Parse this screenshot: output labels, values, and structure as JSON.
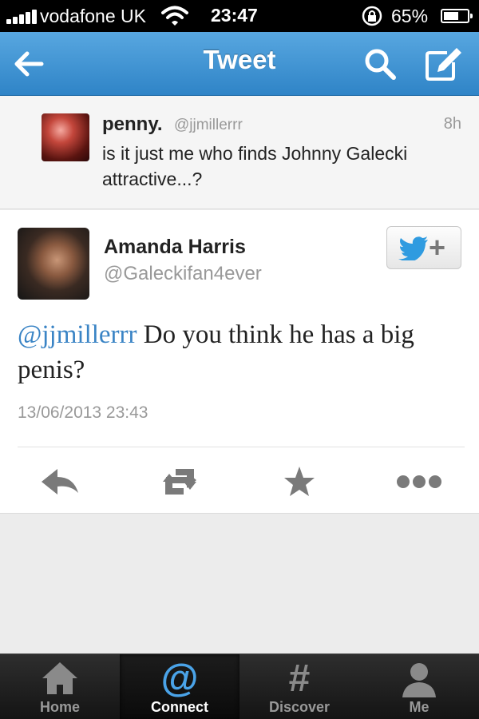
{
  "status_bar": {
    "carrier": "vodafone UK",
    "time": "23:47",
    "battery_percent": "65%",
    "battery_level": 0.65
  },
  "nav": {
    "title": "Tweet",
    "icons": [
      "back-arrow-icon",
      "search-icon",
      "compose-icon"
    ]
  },
  "parent_tweet": {
    "name": "penny.",
    "handle": "@jjmillerrr",
    "time": "8h",
    "text": "is it just me who finds Johnny Galecki attractive...?"
  },
  "main_tweet": {
    "name": "Amanda Harris",
    "handle": "@Galeckifan4ever",
    "mention": "@jjmillerrr",
    "text": " Do you think he has a big penis?",
    "date": "13/06/2013 23:43",
    "follow_icon": "twitter-follow-icon",
    "actions": [
      "reply-icon",
      "retweet-icon",
      "favorite-icon",
      "more-icon"
    ]
  },
  "tabs": [
    {
      "label": "Home",
      "icon": "home-icon"
    },
    {
      "label": "Connect",
      "icon": "at-icon"
    },
    {
      "label": "Discover",
      "icon": "hash-icon"
    },
    {
      "label": "Me",
      "icon": "person-icon"
    }
  ],
  "colors": {
    "nav_blue": "#3a8fd2",
    "mention_blue": "#3a84c5",
    "connect_icon": "#4aa3e8",
    "twitter_bird": "#2f9be0"
  }
}
